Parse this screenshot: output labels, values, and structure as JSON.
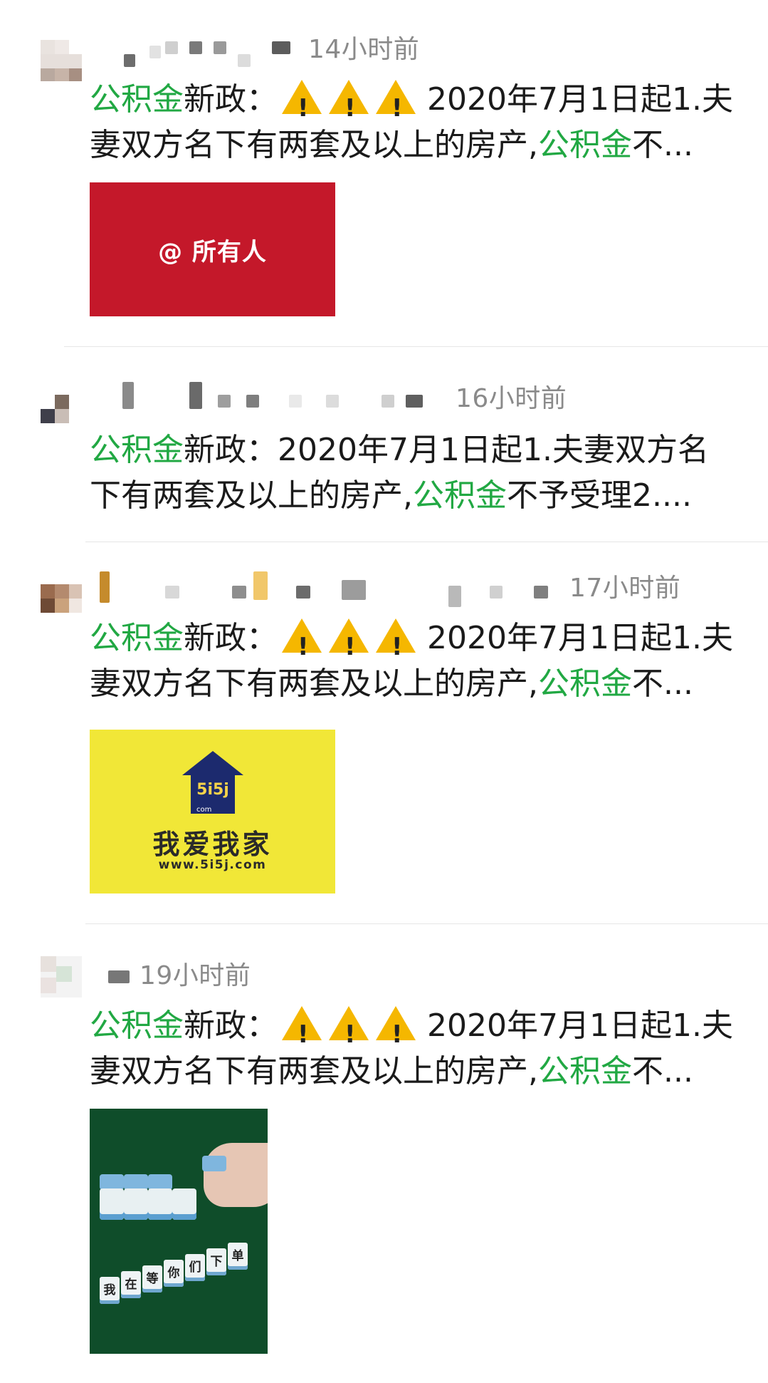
{
  "posts": [
    {
      "time": "14小时前",
      "keyword": "公积金",
      "line1_after_keyword": "新政：",
      "warning_count": 3,
      "line1_tail": "2020年7月1日起1.夫",
      "line2_head": "妻双方名下有两套及以上的房产,",
      "line2_keyword": "公积金",
      "line2_tail": "不...",
      "thumbnail_caption": "@ 所有人"
    },
    {
      "time": "16小时前",
      "keyword": "公积金",
      "line1_after_keyword": "新政：2020年7月1日起1.夫妻双方名",
      "line2_head": "下有两套及以上的房产,",
      "line2_keyword": "公积金",
      "line2_tail": "不予受理2...."
    },
    {
      "time": "17小时前",
      "keyword": "公积金",
      "line1_after_keyword": "新政：",
      "warning_count": 3,
      "line1_tail": "2020年7月1日起1.夫",
      "line2_head": "妻双方名下有两套及以上的房产,",
      "line2_keyword": "公积金",
      "line2_tail": "不...",
      "thumbnail_brand": "我爱我家",
      "thumbnail_url": "www.5i5j.com",
      "thumbnail_logo": "5i5j",
      "thumbnail_logo_sub": "com"
    },
    {
      "time": "19小时前",
      "keyword": "公积金",
      "line1_after_keyword": "新政：",
      "warning_count": 3,
      "line1_tail": "2020年7月1日起1.夫",
      "line2_head": "妻双方名下有两套及以上的房产,",
      "line2_keyword": "公积金",
      "line2_tail": "不...",
      "thumbnail_tiles_text": [
        "我",
        "在",
        "等",
        "你",
        "们",
        "下",
        "单"
      ]
    }
  ],
  "colors": {
    "keyword_green": "#21a843",
    "time_gray": "#8a8a8a",
    "warning_yellow": "#f5b700"
  },
  "icons": [
    "warning-icon"
  ]
}
